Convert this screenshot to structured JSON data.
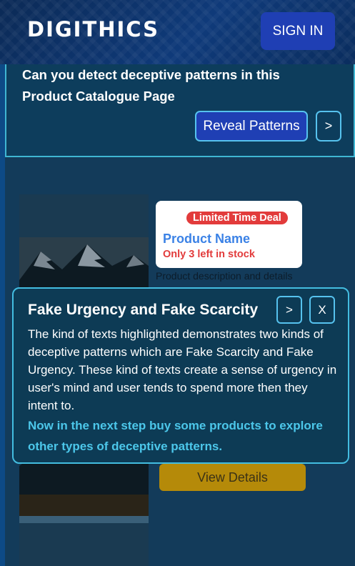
{
  "header": {
    "logo": "DIGITHICS",
    "signin_label": "SIGN IN"
  },
  "banner": {
    "question": "Can you detect deceptive patterns in this Product Catalogue Page",
    "reveal_label": "Reveal Patterns",
    "next_label": ">"
  },
  "product": {
    "badge": "Limited Time Deal",
    "name": "Product Name",
    "stock": "Only 3 left in stock",
    "description": "Product description and details",
    "view_label": "View Details"
  },
  "popup": {
    "title": "Fake Urgency and Fake Scarcity",
    "next_label": ">",
    "close_label": "X",
    "body": "The kind of texts highlighted demonstrates two kinds of deceptive patterns which are Fake Scarcity and Fake Urgency. These kind of texts create a sense of urgency in user's mind and user tends to spend more then they intent to.",
    "cta": "Now in the next step buy some products to explore other types of deceptive patterns."
  },
  "colors": {
    "accent": "#1f3fb4",
    "border": "#43bde0",
    "urgency_red": "#e23b3b",
    "link_blue": "#3b82e6",
    "cta_cyan": "#4cc7ea"
  },
  "icons": {
    "next": "chevron-right-icon",
    "close": "close-icon"
  }
}
